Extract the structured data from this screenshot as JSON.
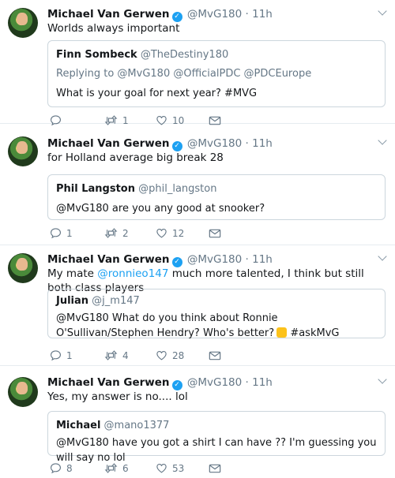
{
  "tweets": [
    {
      "name": "Michael Van Gerwen",
      "handle": "@MvG180",
      "time": "11h",
      "text": "Worlds always important",
      "quote": {
        "name": "Finn Sombeck",
        "handle": "@TheDestiny180",
        "replying": "Replying to @MvG180 @OfficialPDC @PDCEurope",
        "text": "What is your goal for next year? #MVG"
      },
      "replies": "",
      "retweets": "1",
      "likes": "10"
    },
    {
      "name": "Michael Van Gerwen",
      "handle": "@MvG180",
      "time": "11h",
      "text": "for Holland average big break 28",
      "quote": {
        "name": "Phil Langston",
        "handle": "@phil_langston",
        "text": "@MvG180 are you any good at snooker?"
      },
      "replies": "1",
      "retweets": "2",
      "likes": "12"
    },
    {
      "name": "Michael Van Gerwen",
      "handle": "@MvG180",
      "time": "11h",
      "text_before": "My mate ",
      "text_mention": "@ronnieo147",
      "text_after": " much more talented, I think but still both class players",
      "quote": {
        "name": "Julian",
        "handle": "@j_m147",
        "text": "@MvG180 What do you think about Ronnie O'Sullivan/Stephen Hendry? Who's better?",
        "hashtag": "#askMvG"
      },
      "replies": "1",
      "retweets": "4",
      "likes": "28"
    },
    {
      "name": "Michael Van Gerwen",
      "handle": "@MvG180",
      "time": "11h",
      "text": "Yes, my answer is no.... lol",
      "quote": {
        "name": "Michael",
        "handle": "@mano1377",
        "text": "@MvG180 have you got a shirt I can have ?? I'm guessing you will say no lol"
      },
      "replies": "8",
      "retweets": "6",
      "likes": "53"
    }
  ],
  "icons": {
    "verified": "verified-badge-icon",
    "reply": "reply-icon",
    "retweet": "retweet-icon",
    "like": "heart-icon",
    "message": "envelope-icon"
  },
  "colors": {
    "verified": "#1da1f2",
    "mention": "#1da1f2",
    "muted": "#657786",
    "border": "#ccd6dd"
  }
}
